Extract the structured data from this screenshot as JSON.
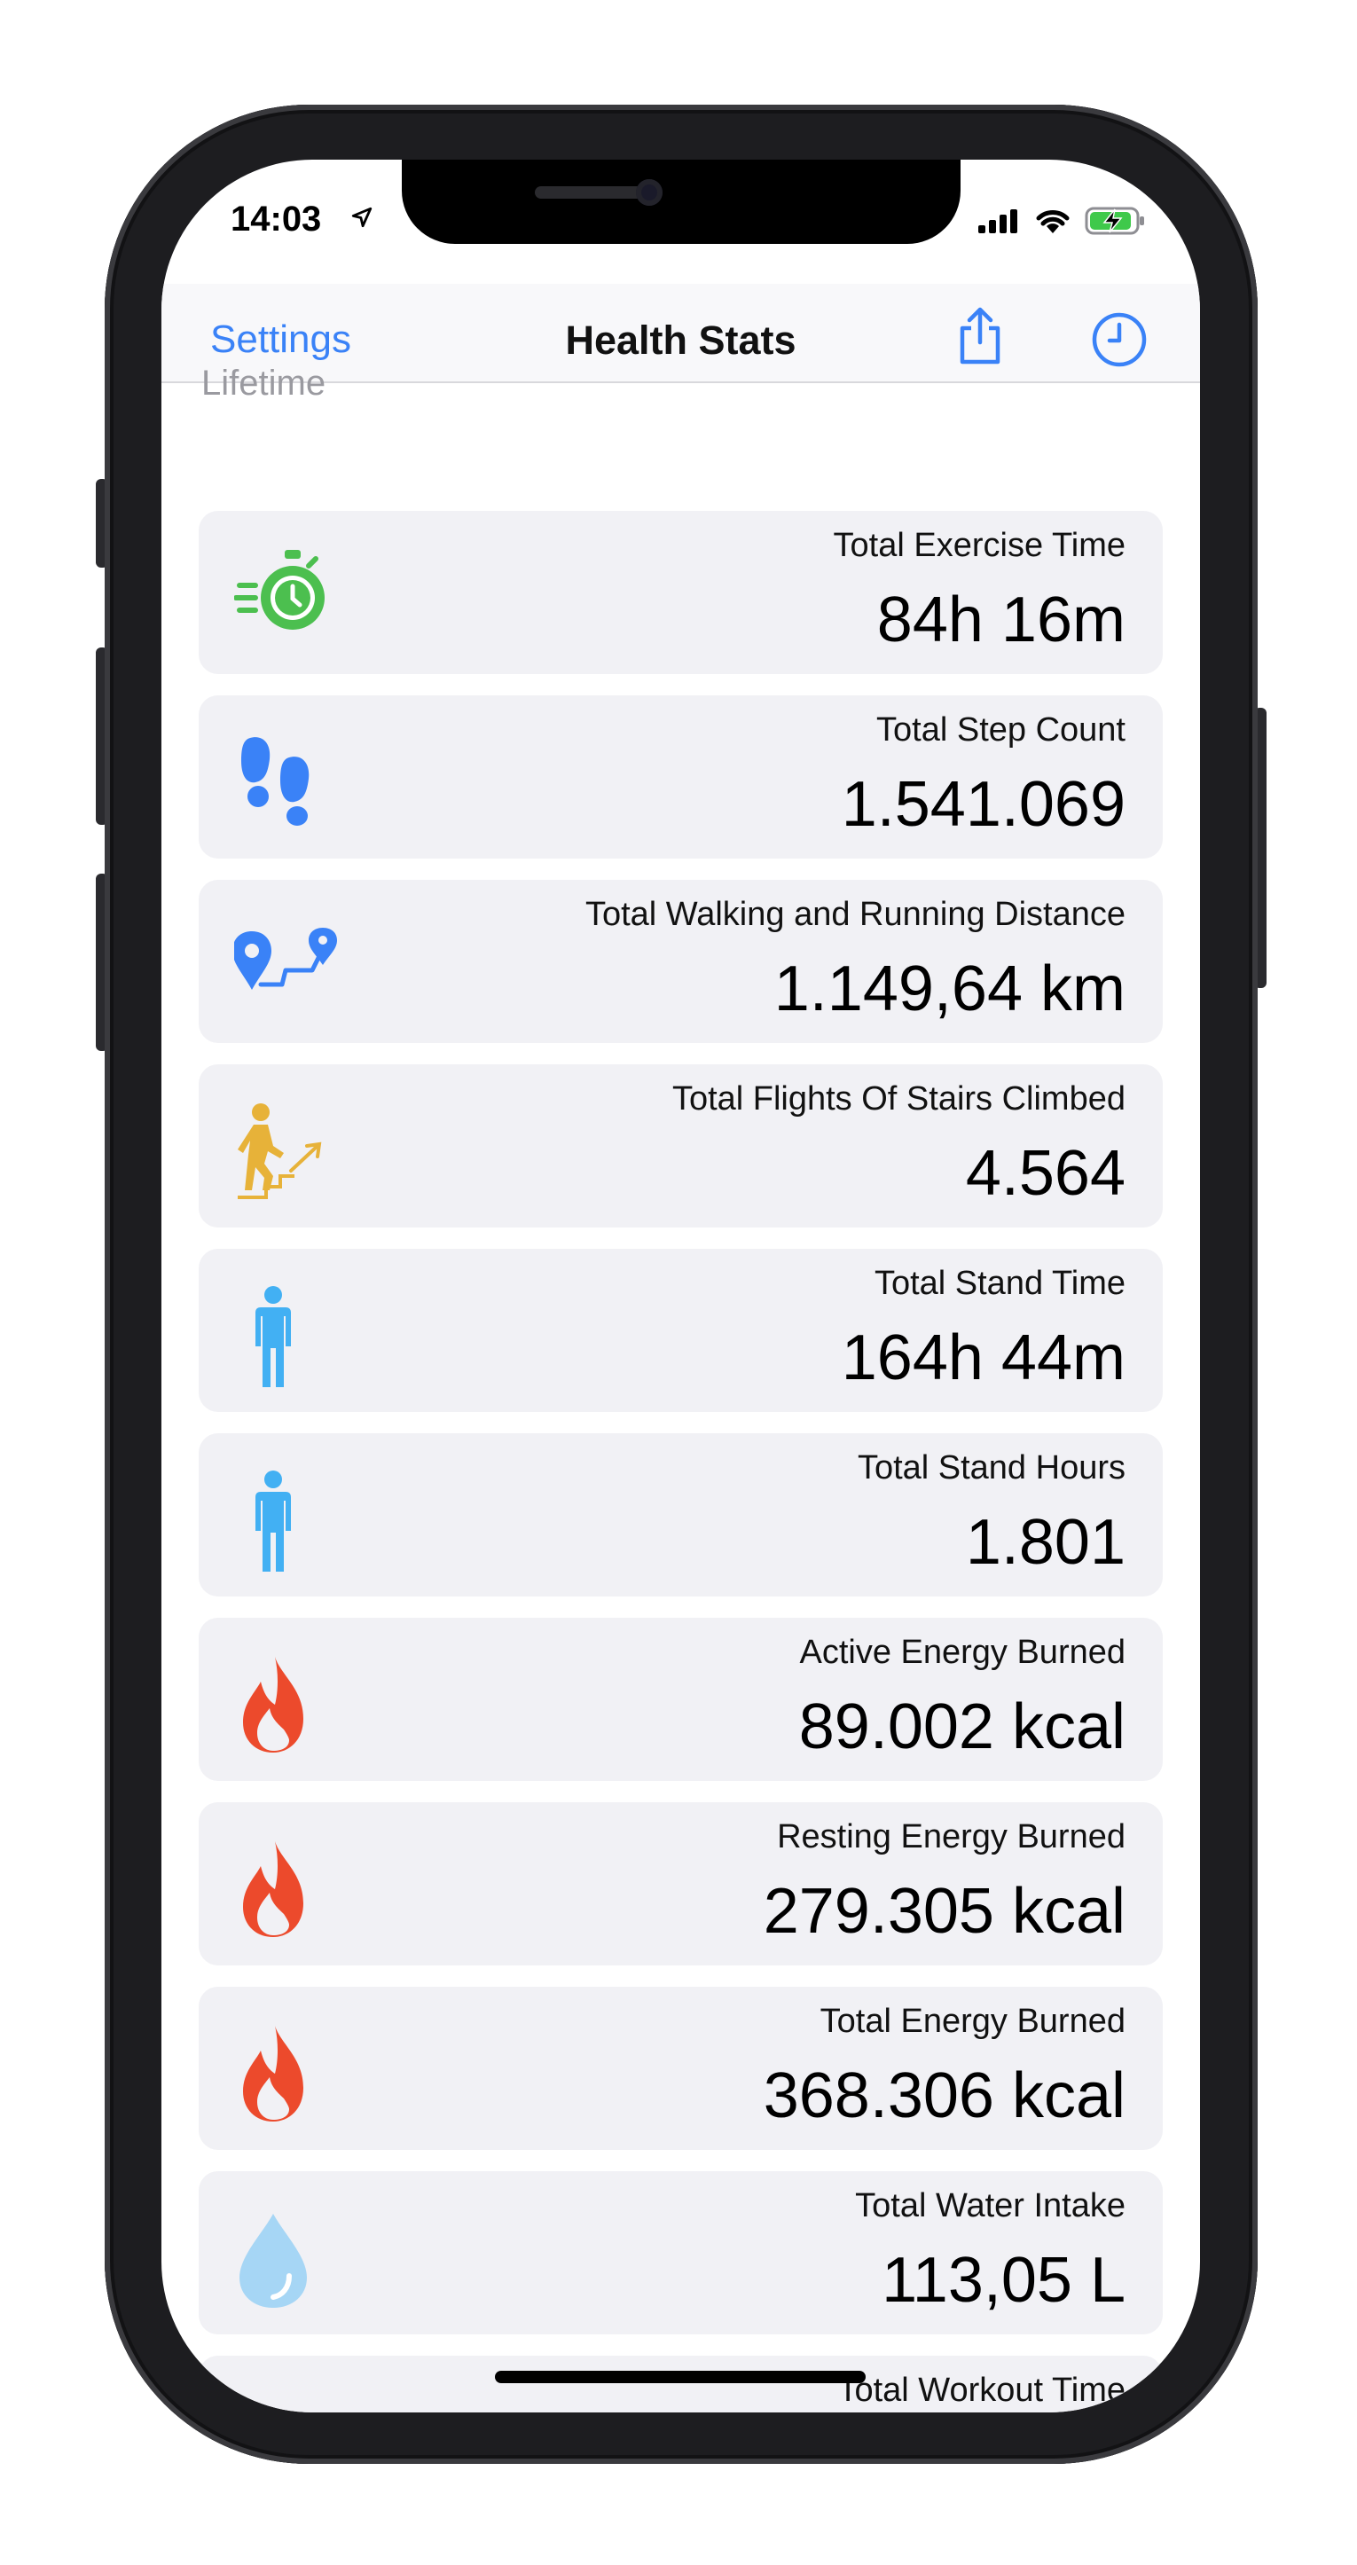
{
  "status": {
    "time": "14:03"
  },
  "nav": {
    "settings": "Settings",
    "title": "Health Stats"
  },
  "section": "Lifetime",
  "stats": [
    {
      "label": "Total Exercise Time",
      "value": "84h 16m",
      "icon": "stopwatch-icon"
    },
    {
      "label": "Total Step Count",
      "value": "1.541.069",
      "icon": "footprints-icon"
    },
    {
      "label": "Total Walking and Running Distance",
      "value": "1.149,64 km",
      "icon": "route-icon"
    },
    {
      "label": "Total Flights Of Stairs Climbed",
      "value": "4.564",
      "icon": "stairs-icon"
    },
    {
      "label": "Total Stand Time",
      "value": "164h 44m",
      "icon": "standing-person-icon"
    },
    {
      "label": "Total Stand Hours",
      "value": "1.801",
      "icon": "standing-person-icon"
    },
    {
      "label": "Active Energy Burned",
      "value": "89.002 kcal",
      "icon": "flame-icon"
    },
    {
      "label": "Resting Energy Burned",
      "value": "279.305 kcal",
      "icon": "flame-icon"
    },
    {
      "label": "Total Energy Burned",
      "value": "368.306 kcal",
      "icon": "flame-icon"
    },
    {
      "label": "Total Water Intake",
      "value": "113,05 L",
      "icon": "water-drop-icon"
    },
    {
      "label": "Total Workout Time",
      "value": "",
      "icon": "workout-icon"
    }
  ],
  "colors": {
    "accent": "#3a82f7",
    "green": "#4cbf4f",
    "blue": "#3a82f7",
    "yellow": "#e7b239",
    "cyan": "#42b0f3",
    "red": "#ec4a2c",
    "water": "#a6d6f5"
  }
}
